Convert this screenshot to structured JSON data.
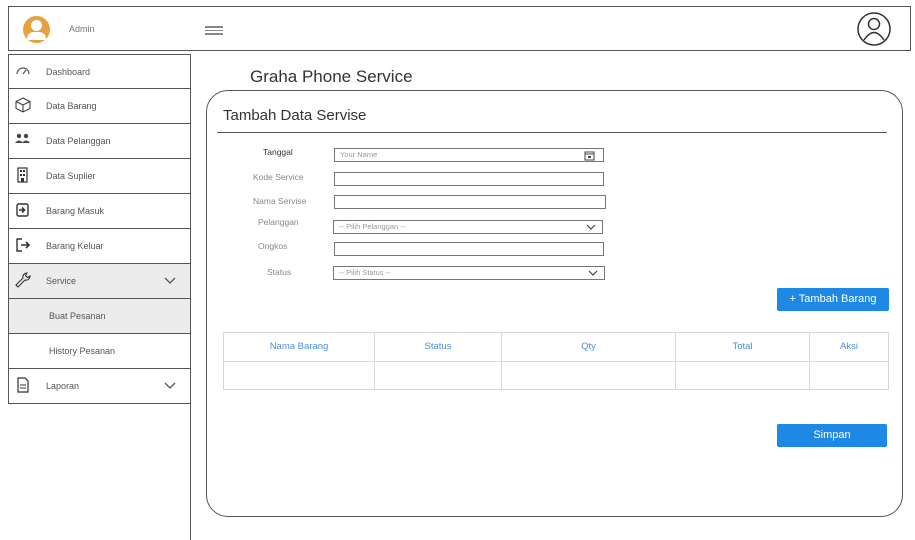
{
  "header": {
    "admin_label": "Admin"
  },
  "sidebar": {
    "items": [
      {
        "label": "Dashboard"
      },
      {
        "label": "Data Barang"
      },
      {
        "label": "Data Pelanggan"
      },
      {
        "label": "Data Suplier"
      },
      {
        "label": "Barang Masuk"
      },
      {
        "label": "Barang Keluar"
      },
      {
        "label": "Service"
      },
      {
        "label": "Buat Pesanan"
      },
      {
        "label": "History Pesanan"
      },
      {
        "label": "Laporan"
      }
    ]
  },
  "main": {
    "app_title": "Graha Phone Service",
    "form_title": "Tambah Data Servise",
    "fields": {
      "tanggal": {
        "label": "Tanggal",
        "placeholder": "Your Name"
      },
      "kode": {
        "label": "Kode Service",
        "value": ""
      },
      "nama": {
        "label": "Nama Servise",
        "value": ""
      },
      "pelanggan": {
        "label": "Pelanggan",
        "selected": "-- Pilih Pelanggan --"
      },
      "ongkos": {
        "label": "Ongkos",
        "value": ""
      },
      "status": {
        "label": "Status",
        "selected": "-- Pilih Status --"
      }
    },
    "add_item_button": "+ Tambah Barang",
    "table": {
      "headers": [
        "Nama Barang",
        "Status",
        "Qty",
        "Total",
        "Aksi"
      ]
    },
    "save_button": "Simpan"
  },
  "colors": {
    "accent": "#1e88e5",
    "avatar": "#e6a23c",
    "table_header_text": "#4a90e2"
  }
}
